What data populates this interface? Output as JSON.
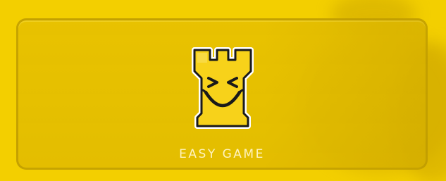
{
  "button": {
    "label": "EASY GAME",
    "icon": "rook-smiley-icon"
  },
  "colors": {
    "background": "#f3cf00",
    "card": "#e4bd00",
    "label_text": "#fff3bf",
    "icon_fill": "#f7d21a",
    "icon_outline": "#1a1a1a"
  }
}
